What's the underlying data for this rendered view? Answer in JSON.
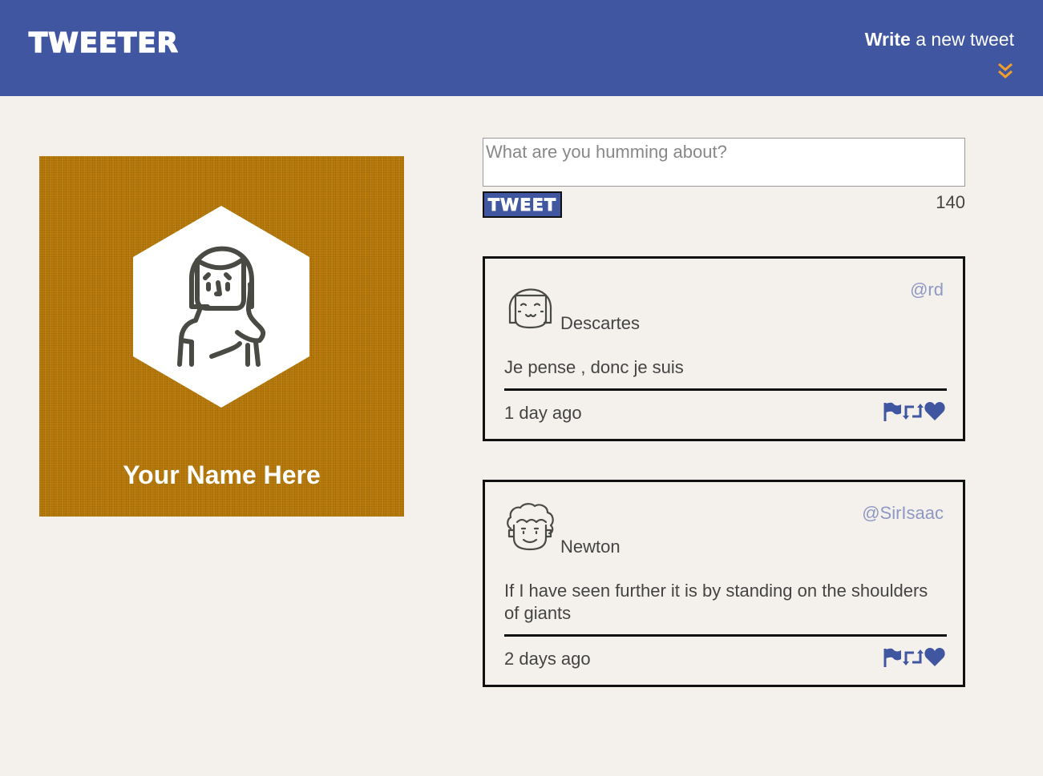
{
  "header": {
    "brand": "TWEETER",
    "compose_bold": "Write",
    "compose_rest": " a new tweet"
  },
  "profile": {
    "name": "Your Name Here",
    "avatar_icon": "woman-avatar-icon"
  },
  "composer": {
    "placeholder": "What are you humming about?",
    "button_label": "TWEET",
    "counter": "140"
  },
  "tweets": [
    {
      "name": "Descartes",
      "handle": "@rd",
      "content": "Je pense , donc je suis",
      "age": "1 day ago",
      "avatar_icon": "girl-avatar-icon"
    },
    {
      "name": "Newton",
      "handle": "@SirIsaac",
      "content": "If I have seen further it is by standing on the shoulders of giants",
      "age": "2 days ago",
      "avatar_icon": "curly-hair-avatar-icon"
    }
  ],
  "icons": {
    "flag": "flag-icon",
    "retweet": "retweet-icon",
    "like": "heart-icon",
    "toggle": "double-chevron-down-icon"
  },
  "colors": {
    "nav": "#4056a1",
    "background": "#f4f1ec",
    "profile_card": "#b87a0a",
    "accent": "#f19e2a",
    "handle": "#8f97c4"
  }
}
